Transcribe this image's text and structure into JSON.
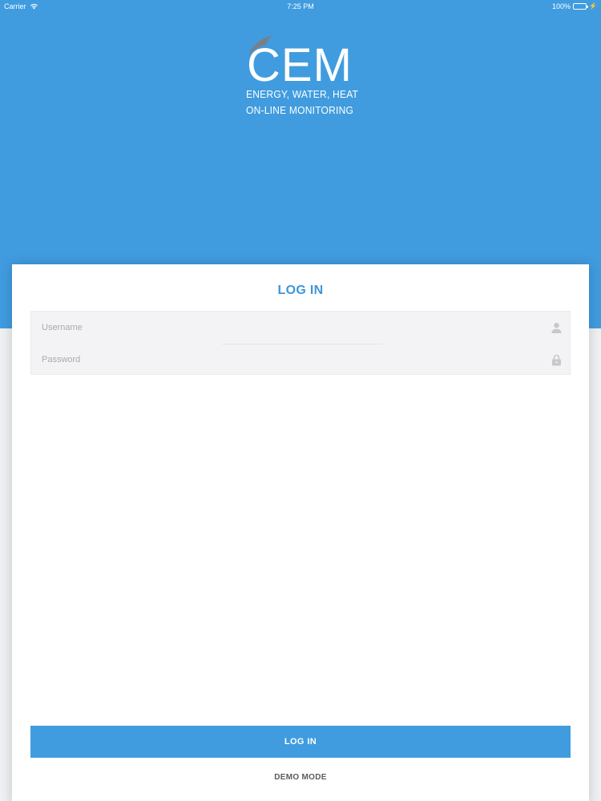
{
  "status_bar": {
    "carrier": "Carrier",
    "time": "7:25 PM",
    "battery": "100%"
  },
  "logo": {
    "letters": "CEM",
    "tagline_1": "ENERGY, WATER, HEAT",
    "tagline_2": "ON-LINE  MONITORING"
  },
  "login": {
    "title": "LOG IN",
    "username_placeholder": "Username",
    "password_placeholder": "Password",
    "submit_label": "LOG IN",
    "demo_label": "DEMO MODE"
  },
  "icons": {
    "username": "user-icon",
    "password": "lock-icon"
  },
  "colors": {
    "brand_blue": "#409cdf",
    "title_blue": "#3d97d8",
    "battery_green": "#4cd964"
  }
}
